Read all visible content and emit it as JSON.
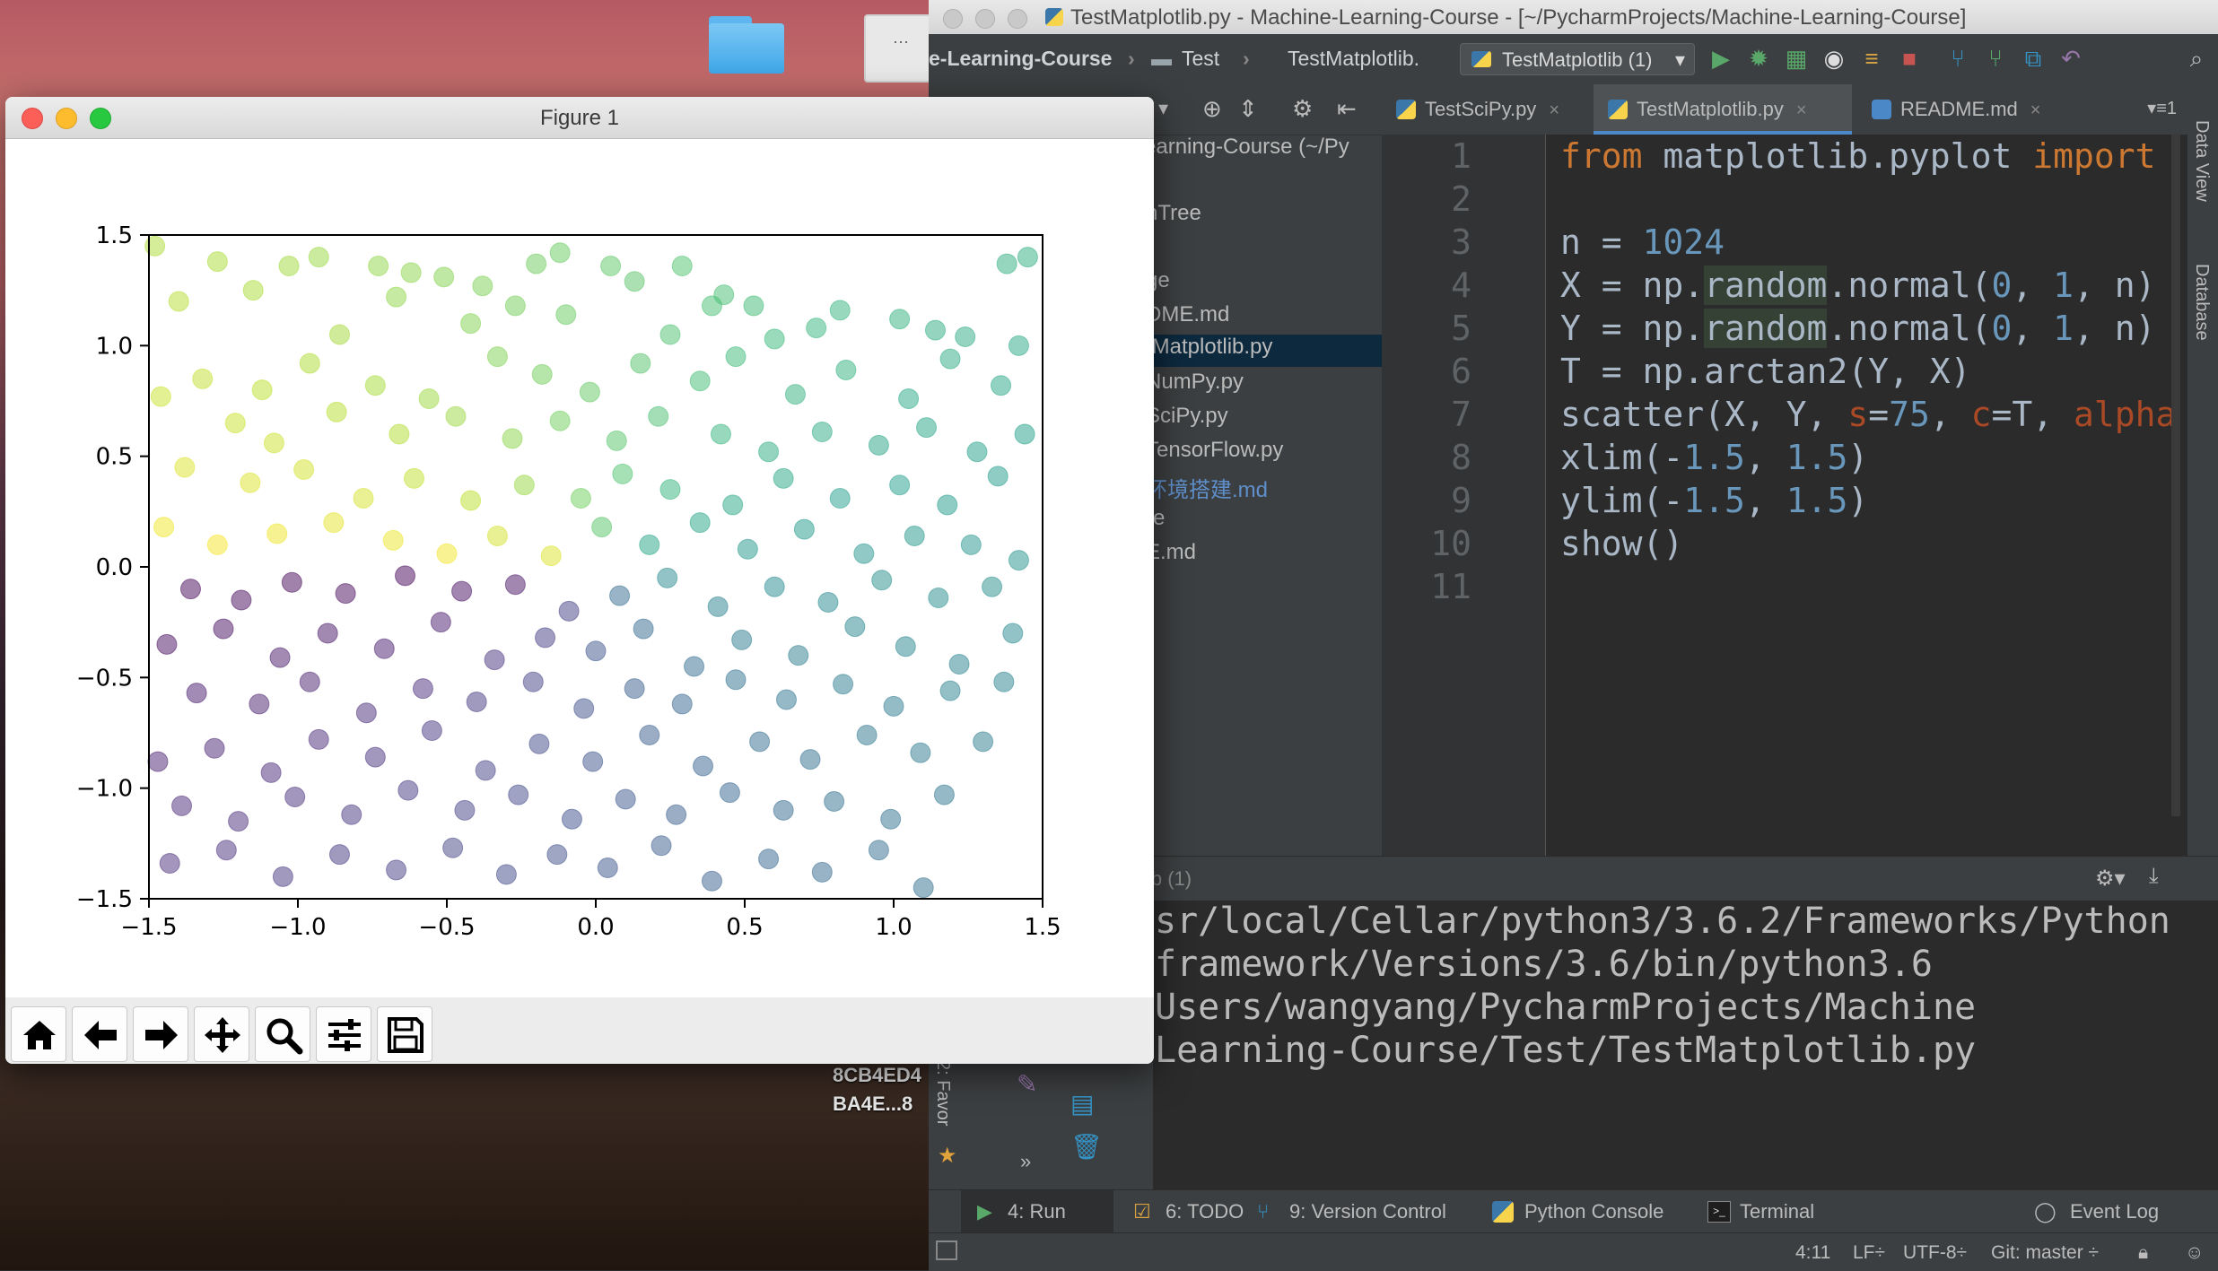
{
  "desktop": {
    "labels": [
      "8CB4ED4",
      "BA4E...8"
    ]
  },
  "figure_window": {
    "title": "Figure 1",
    "toolbar": [
      "home-icon",
      "back-arrow-icon",
      "forward-arrow-icon",
      "pan-icon",
      "zoom-icon",
      "configure-subplots-icon",
      "save-icon"
    ]
  },
  "chart_data": {
    "type": "scatter",
    "title": "",
    "xlabel": "",
    "ylabel": "",
    "xlim": [
      -1.5,
      1.5
    ],
    "ylim": [
      -1.5,
      1.5
    ],
    "xticks": [
      "−1.5",
      "−1.0",
      "−0.5",
      "0.0",
      "0.5",
      "1.0",
      "1.5"
    ],
    "yticks": [
      "1.5",
      "1.0",
      "0.5",
      "0.0",
      "−0.5",
      "−1.0",
      "−1.5"
    ],
    "colormap": "viridis, color = arctan2(Y, X)",
    "point_size": 75,
    "alpha": 0.5,
    "n": 1024,
    "grid": false,
    "series": [
      {
        "points": [
          [
            -1.48,
            1.45
          ],
          [
            -1.27,
            1.38
          ],
          [
            -1.03,
            1.36
          ],
          [
            -0.93,
            1.4
          ],
          [
            -0.73,
            1.36
          ],
          [
            -0.62,
            1.33
          ],
          [
            -0.51,
            1.31
          ],
          [
            -0.38,
            1.27
          ],
          [
            -0.2,
            1.37
          ],
          [
            -0.12,
            1.42
          ],
          [
            0.05,
            1.36
          ],
          [
            0.29,
            1.36
          ],
          [
            0.43,
            1.23
          ],
          [
            0.53,
            1.18
          ],
          [
            0.82,
            1.16
          ],
          [
            1.02,
            1.12
          ],
          [
            1.38,
            1.37
          ],
          [
            1.45,
            1.4
          ],
          [
            -1.4,
            1.2
          ],
          [
            -1.15,
            1.25
          ],
          [
            -0.86,
            1.05
          ],
          [
            -0.67,
            1.22
          ],
          [
            -0.42,
            1.1
          ],
          [
            -0.27,
            1.18
          ],
          [
            -0.1,
            1.14
          ],
          [
            0.13,
            1.29
          ],
          [
            0.25,
            1.05
          ],
          [
            0.39,
            1.18
          ],
          [
            0.6,
            1.03
          ],
          [
            0.74,
            1.08
          ],
          [
            1.14,
            1.07
          ],
          [
            1.24,
            1.04
          ],
          [
            1.42,
            1.0
          ],
          [
            -1.32,
            0.85
          ],
          [
            -1.12,
            0.8
          ],
          [
            -0.96,
            0.92
          ],
          [
            -0.74,
            0.82
          ],
          [
            -0.56,
            0.76
          ],
          [
            -0.33,
            0.95
          ],
          [
            -0.18,
            0.87
          ],
          [
            -0.02,
            0.79
          ],
          [
            0.15,
            0.92
          ],
          [
            0.35,
            0.84
          ],
          [
            0.47,
            0.95
          ],
          [
            0.67,
            0.78
          ],
          [
            0.84,
            0.89
          ],
          [
            1.05,
            0.76
          ],
          [
            1.19,
            0.94
          ],
          [
            1.36,
            0.82
          ],
          [
            -1.46,
            0.77
          ],
          [
            -1.21,
            0.65
          ],
          [
            -1.08,
            0.56
          ],
          [
            -0.87,
            0.7
          ],
          [
            -0.66,
            0.6
          ],
          [
            -0.47,
            0.68
          ],
          [
            -0.28,
            0.58
          ],
          [
            -0.12,
            0.66
          ],
          [
            0.07,
            0.57
          ],
          [
            0.21,
            0.68
          ],
          [
            0.42,
            0.6
          ],
          [
            0.58,
            0.52
          ],
          [
            0.76,
            0.61
          ],
          [
            0.95,
            0.55
          ],
          [
            1.11,
            0.63
          ],
          [
            1.28,
            0.52
          ],
          [
            1.44,
            0.6
          ],
          [
            -1.38,
            0.45
          ],
          [
            -1.16,
            0.38
          ],
          [
            -0.98,
            0.44
          ],
          [
            -0.78,
            0.31
          ],
          [
            -0.61,
            0.4
          ],
          [
            -0.42,
            0.3
          ],
          [
            -0.24,
            0.37
          ],
          [
            -0.05,
            0.31
          ],
          [
            0.09,
            0.42
          ],
          [
            0.25,
            0.35
          ],
          [
            0.46,
            0.28
          ],
          [
            0.63,
            0.4
          ],
          [
            0.82,
            0.31
          ],
          [
            1.02,
            0.37
          ],
          [
            1.18,
            0.28
          ],
          [
            1.35,
            0.41
          ],
          [
            -1.45,
            0.18
          ],
          [
            -1.27,
            0.1
          ],
          [
            -1.07,
            0.15
          ],
          [
            -0.88,
            0.2
          ],
          [
            -0.68,
            0.12
          ],
          [
            -0.5,
            0.06
          ],
          [
            -0.33,
            0.14
          ],
          [
            -0.15,
            0.05
          ],
          [
            0.02,
            0.18
          ],
          [
            0.18,
            0.1
          ],
          [
            0.35,
            0.2
          ],
          [
            0.51,
            0.08
          ],
          [
            0.7,
            0.17
          ],
          [
            0.9,
            0.06
          ],
          [
            1.07,
            0.14
          ],
          [
            1.26,
            0.1
          ],
          [
            1.42,
            0.03
          ],
          [
            -1.36,
            -0.1
          ],
          [
            -1.19,
            -0.15
          ],
          [
            -1.02,
            -0.07
          ],
          [
            -0.84,
            -0.12
          ],
          [
            -0.64,
            -0.04
          ],
          [
            -0.45,
            -0.11
          ],
          [
            -0.27,
            -0.08
          ],
          [
            -0.09,
            -0.2
          ],
          [
            0.08,
            -0.13
          ],
          [
            0.24,
            -0.05
          ],
          [
            0.41,
            -0.18
          ],
          [
            0.6,
            -0.09
          ],
          [
            0.78,
            -0.16
          ],
          [
            0.96,
            -0.06
          ],
          [
            1.15,
            -0.14
          ],
          [
            1.33,
            -0.09
          ],
          [
            -1.44,
            -0.35
          ],
          [
            -1.25,
            -0.28
          ],
          [
            -1.06,
            -0.41
          ],
          [
            -0.9,
            -0.3
          ],
          [
            -0.71,
            -0.37
          ],
          [
            -0.52,
            -0.25
          ],
          [
            -0.34,
            -0.42
          ],
          [
            -0.17,
            -0.32
          ],
          [
            0.0,
            -0.38
          ],
          [
            0.16,
            -0.28
          ],
          [
            0.33,
            -0.45
          ],
          [
            0.49,
            -0.33
          ],
          [
            0.68,
            -0.4
          ],
          [
            0.87,
            -0.27
          ],
          [
            1.04,
            -0.36
          ],
          [
            1.22,
            -0.44
          ],
          [
            1.4,
            -0.3
          ],
          [
            -1.34,
            -0.57
          ],
          [
            -1.13,
            -0.62
          ],
          [
            -0.96,
            -0.52
          ],
          [
            -0.77,
            -0.66
          ],
          [
            -0.58,
            -0.55
          ],
          [
            -0.4,
            -0.61
          ],
          [
            -0.21,
            -0.52
          ],
          [
            -0.04,
            -0.64
          ],
          [
            0.13,
            -0.55
          ],
          [
            0.29,
            -0.62
          ],
          [
            0.47,
            -0.51
          ],
          [
            0.64,
            -0.6
          ],
          [
            0.83,
            -0.53
          ],
          [
            1.0,
            -0.63
          ],
          [
            1.19,
            -0.56
          ],
          [
            1.37,
            -0.52
          ],
          [
            -1.47,
            -0.88
          ],
          [
            -1.28,
            -0.82
          ],
          [
            -1.09,
            -0.93
          ],
          [
            -0.93,
            -0.78
          ],
          [
            -0.74,
            -0.86
          ],
          [
            -0.55,
            -0.74
          ],
          [
            -0.37,
            -0.92
          ],
          [
            -0.19,
            -0.8
          ],
          [
            -0.01,
            -0.88
          ],
          [
            0.18,
            -0.76
          ],
          [
            0.36,
            -0.9
          ],
          [
            0.55,
            -0.79
          ],
          [
            0.72,
            -0.87
          ],
          [
            0.91,
            -0.76
          ],
          [
            1.09,
            -0.84
          ],
          [
            1.3,
            -0.79
          ],
          [
            -1.39,
            -1.08
          ],
          [
            -1.2,
            -1.15
          ],
          [
            -1.01,
            -1.04
          ],
          [
            -0.82,
            -1.12
          ],
          [
            -0.63,
            -1.01
          ],
          [
            -0.44,
            -1.1
          ],
          [
            -0.26,
            -1.03
          ],
          [
            -0.08,
            -1.14
          ],
          [
            0.1,
            -1.05
          ],
          [
            0.27,
            -1.12
          ],
          [
            0.45,
            -1.02
          ],
          [
            0.63,
            -1.1
          ],
          [
            0.8,
            -1.06
          ],
          [
            0.99,
            -1.14
          ],
          [
            1.17,
            -1.03
          ],
          [
            -1.43,
            -1.34
          ],
          [
            -1.24,
            -1.28
          ],
          [
            -1.05,
            -1.4
          ],
          [
            -0.86,
            -1.3
          ],
          [
            -0.67,
            -1.37
          ],
          [
            -0.48,
            -1.27
          ],
          [
            -0.3,
            -1.39
          ],
          [
            -0.13,
            -1.3
          ],
          [
            0.04,
            -1.36
          ],
          [
            0.22,
            -1.26
          ],
          [
            0.39,
            -1.42
          ],
          [
            0.58,
            -1.32
          ],
          [
            0.76,
            -1.38
          ],
          [
            0.95,
            -1.28
          ],
          [
            1.1,
            -1.45
          ]
        ]
      }
    ]
  },
  "ide": {
    "window_title": "TestMatplotlib.py - Machine-Learning-Course - [~/PycharmProjects/Machine-Learning-Course]",
    "breadcrumbs": [
      "e-Learning-Course",
      "Test",
      "TestMatplotlib."
    ],
    "run_config": "TestMatplotlib (1)",
    "project_header": "earning-Course (~/Py",
    "project_items": [
      "nTree",
      "ge",
      "DME.md",
      "tMatplotlib.py",
      "NumPy.py",
      "SciPy.py",
      "TensorFlow.py",
      "环境搭建.md",
      "re",
      "E.md"
    ],
    "tabs": [
      "TestSciPy.py",
      "TestMatplotlib.py",
      "README.md"
    ],
    "line_numbers": [
      "1",
      "2",
      "3",
      "4",
      "5",
      "6",
      "7",
      "8",
      "9",
      "10",
      "11"
    ],
    "run_label": "tlib (1)",
    "output_lines": [
      "sr/local/Cellar/python3/3.6.2/Frameworks/Python",
      "framework/Versions/3.6/bin/python3.6",
      "Users/wangyang/PycharmProjects/Machine",
      "Learning-Course/Test/TestMatplotlib.py"
    ],
    "side_tools": [
      "Data View",
      "Database"
    ],
    "favorites_label": "2: Favor",
    "bottom_tabs": [
      "4: Run",
      "6: TODO",
      "9: Version Control",
      "Python Console",
      "Terminal",
      "Event Log"
    ],
    "status": {
      "position": "4:11",
      "line_sep": "LF÷",
      "encoding": "UTF-8÷",
      "git": "Git: master ÷"
    }
  }
}
